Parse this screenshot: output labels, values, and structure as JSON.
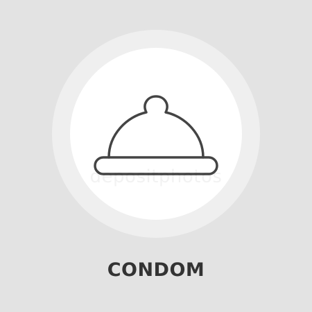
{
  "icon": {
    "name": "condom-icon",
    "stroke_color": "#444444"
  },
  "watermark": {
    "text": "depositphotos"
  },
  "caption": {
    "text": "CONDOM",
    "color": "#333333"
  },
  "colors": {
    "background": "#e3e3e3",
    "ring": "#efefef",
    "disc": "#ffffff"
  }
}
